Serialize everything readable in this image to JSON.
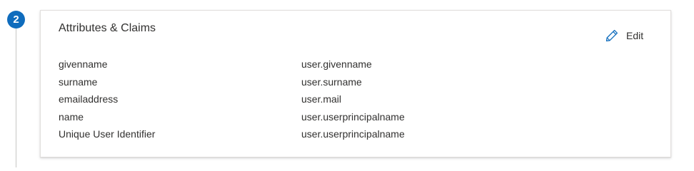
{
  "step": {
    "number": "2"
  },
  "card": {
    "title": "Attributes & Claims",
    "edit_label": "Edit",
    "edit_icon": "pencil-icon",
    "rows": [
      {
        "name": "givenname",
        "value": "user.givenname"
      },
      {
        "name": "surname",
        "value": "user.surname"
      },
      {
        "name": "emailaddress",
        "value": "user.mail"
      },
      {
        "name": "name",
        "value": "user.userprincipalname"
      },
      {
        "name": "Unique User Identifier",
        "value": "user.userprincipalname"
      }
    ]
  },
  "colors": {
    "accent": "#0f6cbd",
    "text": "#323130",
    "border": "#e1dfdd"
  }
}
